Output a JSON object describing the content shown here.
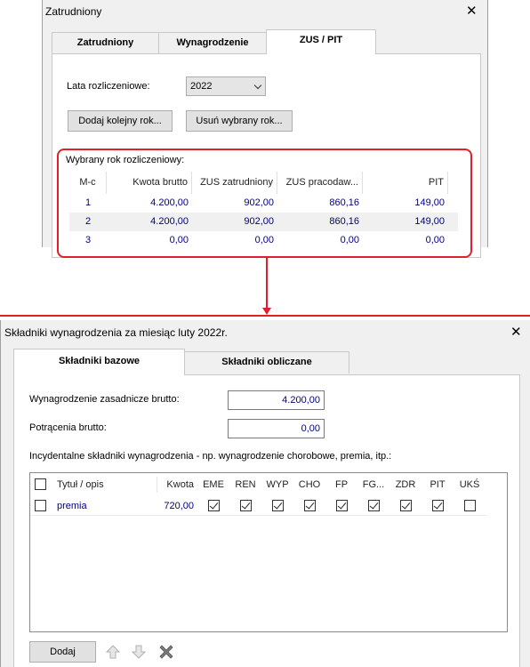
{
  "top_window": {
    "title": "Zatrudniony",
    "tabs": [
      "Zatrudniony",
      "Wynagrodzenie",
      "ZUS / PIT"
    ],
    "active_tab": "ZUS / PIT",
    "years_label": "Lata rozliczeniowe:",
    "year_selected": "2022",
    "add_year_button": "Dodaj kolejny rok...",
    "remove_year_button": "Usuń wybrany rok...",
    "selected_year_label": "Wybrany rok rozliczeniowy:",
    "columns": [
      "M-c",
      "Kwota brutto",
      "ZUS zatrudniony",
      "ZUS pracodaw...",
      "PIT"
    ],
    "rows": [
      {
        "month": "1",
        "gross": "4.200,00",
        "zus_employee": "902,00",
        "zus_employer": "860,16",
        "pit": "149,00"
      },
      {
        "month": "2",
        "gross": "4.200,00",
        "zus_employee": "902,00",
        "zus_employer": "860,16",
        "pit": "149,00"
      },
      {
        "month": "3",
        "gross": "0,00",
        "zus_employee": "0,00",
        "zus_employer": "0,00",
        "pit": "0,00"
      }
    ]
  },
  "bottom_window": {
    "title": "Składniki wynagrodzenia za miesiąc luty 2022r.",
    "tabs": [
      "Składniki bazowe",
      "Składniki obliczane"
    ],
    "active_tab": "Składniki bazowe",
    "base_salary_label": "Wynagrodzenie zasadnicze brutto:",
    "base_salary_value": "4.200,00",
    "deductions_label": "Potrącenia brutto:",
    "deductions_value": "0,00",
    "incidental_label": "Incydentalne składniki wynagrodzenia - np. wynagrodzenie chorobowe, premia, itp.:",
    "columns": [
      "Tytuł / opis",
      "Kwota",
      "EME",
      "REN",
      "WYP",
      "CHO",
      "FP",
      "FG...",
      "ZDR",
      "PIT",
      "UKŚ"
    ],
    "rows": [
      {
        "checked": false,
        "title": "premia",
        "amount": "720,00",
        "flags": [
          true,
          true,
          true,
          true,
          true,
          true,
          true,
          true,
          false
        ]
      }
    ],
    "add_button": "Dodaj"
  },
  "colors": {
    "accent_red": "#e0202a",
    "value_blue": "#00007f"
  },
  "icons": [
    "close-icon",
    "chevron-down-icon",
    "arrow-up-icon",
    "arrow-down-icon",
    "delete-icon"
  ]
}
